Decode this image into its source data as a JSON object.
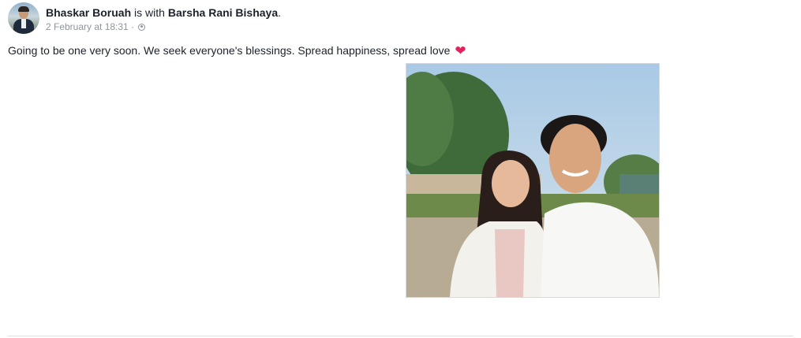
{
  "post": {
    "author": "Bhaskar Boruah",
    "with_text": " is with ",
    "tagged": "Barsha Rani Bishaya",
    "period": ".",
    "timestamp": "2 February at 18:31",
    "separator": " · ",
    "privacy_icon": "globe-icon",
    "text": "Going to be one very soon. We seek everyone's blessings. Spread happiness, spread love",
    "emoji": "❤",
    "emoji_icon": "heart-icon",
    "photo_icon": "couple-selfie-photo"
  },
  "colors": {
    "text": "#1d2129",
    "meta": "#90949c",
    "heart": "#e0245e",
    "divider": "#dddfe2"
  }
}
